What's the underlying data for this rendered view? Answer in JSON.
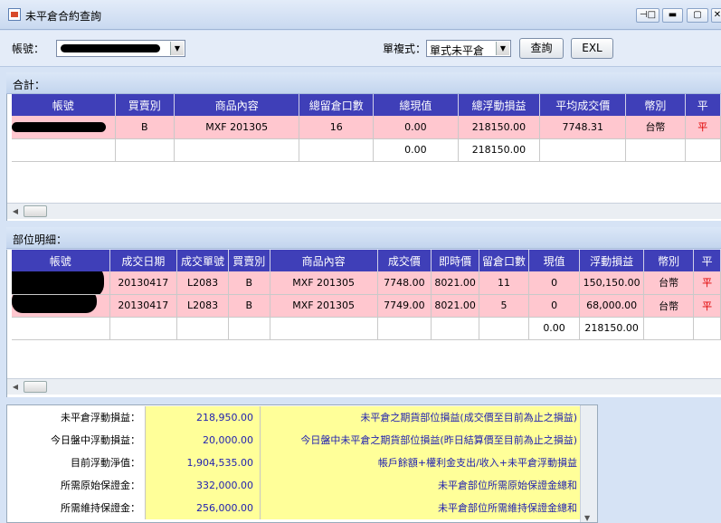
{
  "window": {
    "title": "未平倉合約查詢"
  },
  "toolbar": {
    "account_label": "帳號：",
    "format_label": "單複式：",
    "format_value": "單式未平倉",
    "query_button": "查詢",
    "excel_button": "EXL"
  },
  "summary_section": {
    "title": "合計：",
    "columns": [
      "帳號",
      "買賣別",
      "商品內容",
      "總留倉口數",
      "總現值",
      "總浮動損益",
      "平均成交價",
      "幣別",
      "平"
    ],
    "rows": [
      [
        "",
        "B",
        "MXF 201305",
        "16",
        "0.00",
        "218150.00",
        "7748.31",
        "台幣",
        "平"
      ],
      [
        "",
        "",
        "",
        "",
        "0.00",
        "218150.00",
        "",
        "",
        ""
      ]
    ]
  },
  "detail_section": {
    "title": "部位明細：",
    "columns": [
      "帳號",
      "成交日期",
      "成交單號",
      "買賣別",
      "商品內容",
      "成交價",
      "即時價",
      "留倉口數",
      "現值",
      "浮動損益",
      "幣別",
      "平"
    ],
    "rows": [
      [
        "",
        "20130417",
        "L2083",
        "B",
        "MXF 201305",
        "7748.00",
        "8021.00",
        "11",
        "0",
        "150,150.00",
        "台幣",
        "平"
      ],
      [
        "",
        "20130417",
        "L2083",
        "B",
        "MXF 201305",
        "7749.00",
        "8021.00",
        "5",
        "0",
        "68,000.00",
        "台幣",
        "平"
      ],
      [
        "",
        "",
        "",
        "",
        "",
        "",
        "",
        "",
        "0.00",
        "218150.00",
        "",
        ""
      ]
    ]
  },
  "totals": [
    {
      "label": "未平倉浮動損益：",
      "value": "218,950.00",
      "desc": "未平倉之期貨部位損益(成交價至目前為止之損益)"
    },
    {
      "label": "今日盤中浮動損益：",
      "value": "20,000.00",
      "desc": "今日盤中未平倉之期貨部位損益(昨日結算價至目前為止之損益)"
    },
    {
      "label": "目前浮動淨值：",
      "value": "1,904,535.00",
      "desc": "帳戶餘額+權利金支出/收入+未平倉浮動損益"
    },
    {
      "label": "所需原始保證金：",
      "value": "332,000.00",
      "desc": "未平倉部位所需原始保證金總和"
    },
    {
      "label": "所需維持保證金：",
      "value": "256,000.00",
      "desc": "未平倉部位所需維持保證金總和"
    }
  ]
}
